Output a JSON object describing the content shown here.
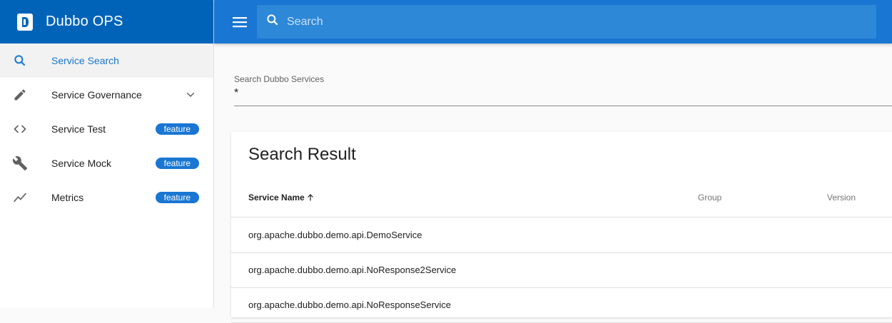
{
  "app": {
    "title": "Dubbo OPS",
    "brand_color": "#0163b8",
    "accent": "#1976d2"
  },
  "sidebar": {
    "items": [
      {
        "label": "Service Search",
        "icon": "search-icon",
        "active": true
      },
      {
        "label": "Service Governance",
        "icon": "pencil-icon",
        "expandable": true
      },
      {
        "label": "Service Test",
        "icon": "code-icon",
        "badge": "feature"
      },
      {
        "label": "Service Mock",
        "icon": "wrench-icon",
        "badge": "feature"
      },
      {
        "label": "Metrics",
        "icon": "trending-icon",
        "badge": "feature"
      }
    ]
  },
  "topbar": {
    "search_placeholder": "Search"
  },
  "main": {
    "search_field": {
      "label": "Search Dubbo Services",
      "value": "*"
    },
    "result": {
      "title": "Search Result",
      "columns": [
        "Service Name",
        "Group",
        "Version"
      ],
      "rows": [
        "org.apache.dubbo.demo.api.DemoService",
        "org.apache.dubbo.demo.api.NoResponse2Service",
        "org.apache.dubbo.demo.api.NoResponseService"
      ]
    }
  }
}
